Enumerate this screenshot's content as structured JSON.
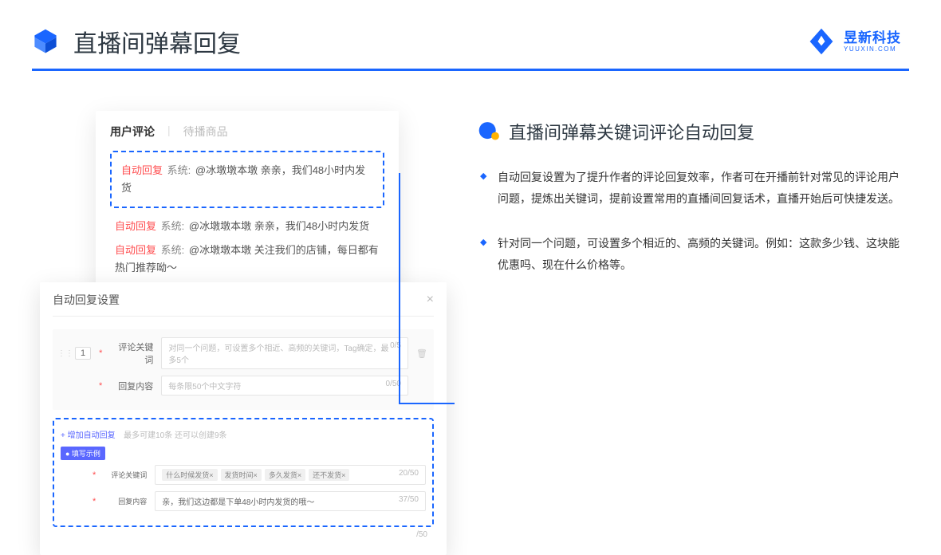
{
  "header": {
    "title": "直播间弹幕回复",
    "brand_cn": "昱新科技",
    "brand_en": "YUUXIN.COM"
  },
  "panel1": {
    "tab_active": "用户评论",
    "tab_inactive": "待播商品",
    "rows": [
      {
        "tag": "自动回复",
        "sys": "系统:",
        "text": "@冰墩墩本墩 亲亲，我们48小时内发货"
      },
      {
        "tag": "自动回复",
        "sys": "系统:",
        "text": "@冰墩墩本墩 亲亲，我们48小时内发货"
      },
      {
        "tag": "自动回复",
        "sys": "系统:",
        "text": "@冰墩墩本墩 关注我们的店铺，每日都有热门推荐呦～"
      }
    ]
  },
  "panel2": {
    "title": "自动回复设置",
    "num": "1",
    "label_kw": "评论关键词",
    "ph_kw": "对同一个问题，可设置多个相近、高频的关键词，Tag确定，最多5个",
    "count_kw": "0/5",
    "label_content": "回复内容",
    "ph_content": "每条限50个中文字符",
    "count_content": "0/50",
    "add_link": "+ 增加自动回复",
    "add_hint": "最多可建10条 还可以创建9条",
    "example_badge": "● 填写示例",
    "ex_label_kw": "评论关键词",
    "ex_tags": [
      "什么时候发货×",
      "发货时间×",
      "多久发货×",
      "还不发货×"
    ],
    "ex_count_kw": "20/50",
    "ex_label_content": "回复内容",
    "ex_content": "亲，我们这边都是下单48小时内发货的哦～",
    "ex_count_content": "37/50",
    "outer_count": "/50"
  },
  "right": {
    "title": "直播间弹幕关键词评论自动回复",
    "bullets": [
      "自动回复设置为了提升作者的评论回复效率，作者可在开播前针对常见的评论用户问题，提炼出关键词，提前设置常用的直播间回复话术，直播开始后可快捷发送。",
      "针对同一个问题，可设置多个相近的、高频的关键词。例如：这款多少钱、这块能优惠吗、现在什么价格等。"
    ]
  }
}
